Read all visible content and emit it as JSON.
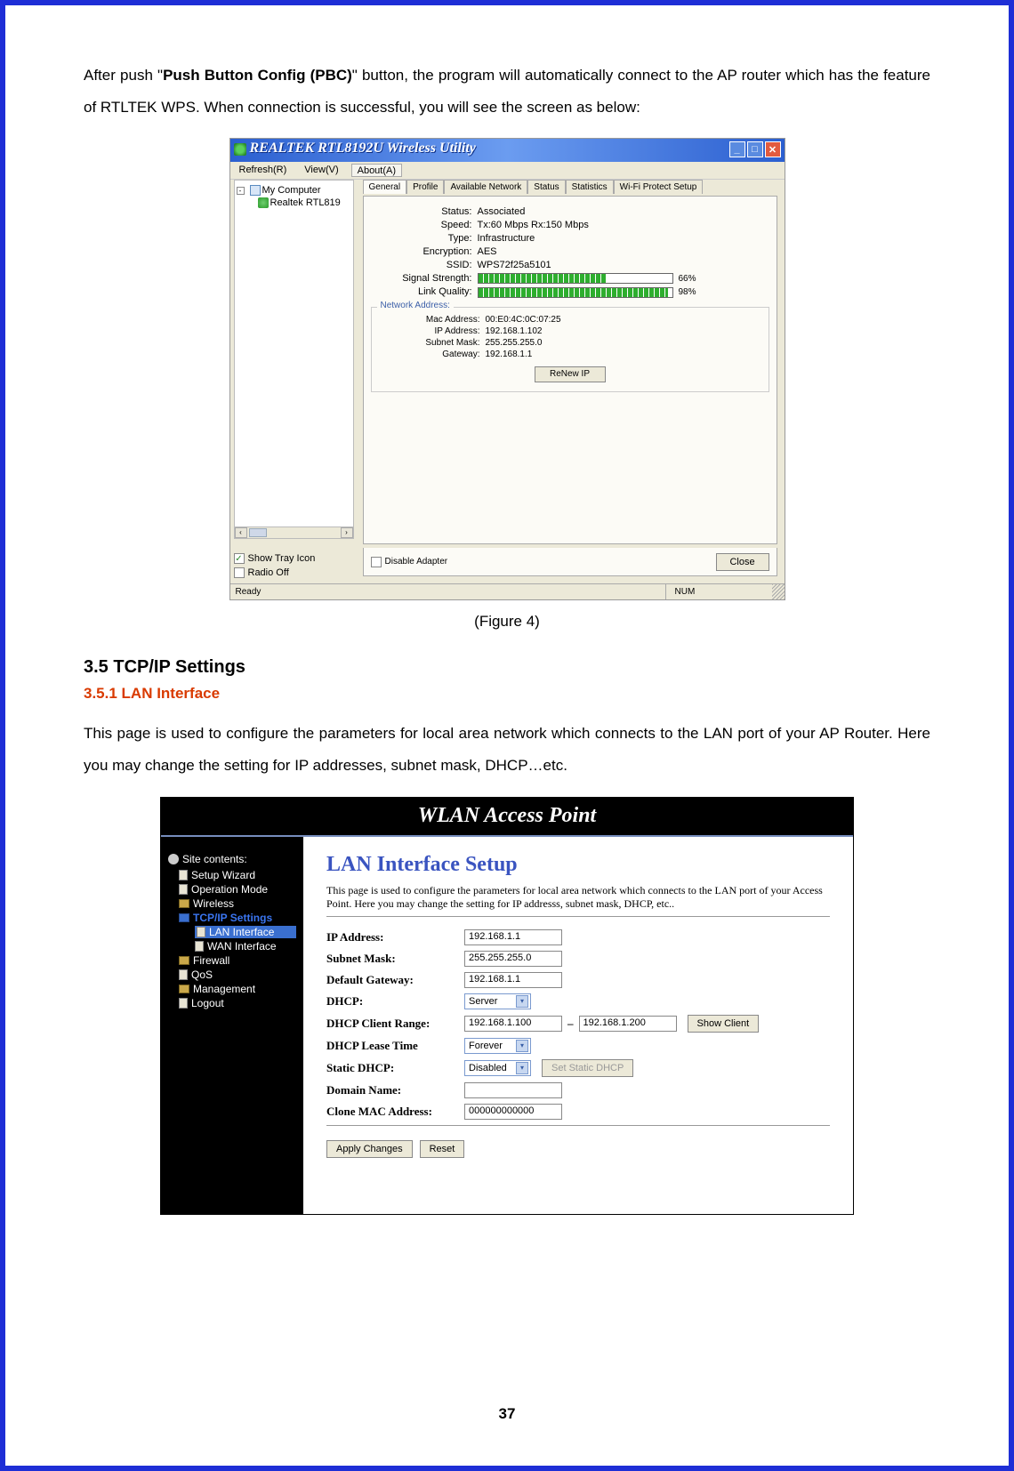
{
  "intro_p1_prefix": "After push \"",
  "intro_p1_bold": "Push Button Config (PBC)",
  "intro_p1_suffix": "\" button, the program will automatically connect to the AP router which has the feature of RTLTEK WPS. When connection is successful, you will see the screen as below:",
  "fig4": {
    "title": "REALTEK RTL8192U Wireless Utility",
    "menu": {
      "refresh": "Refresh(R)",
      "view": "View(V)",
      "about": "About(A)"
    },
    "tree": {
      "root": "My Computer",
      "child": "Realtek RTL819"
    },
    "tabs": {
      "general": "General",
      "profile": "Profile",
      "avail": "Available Network",
      "status": "Status",
      "stats": "Statistics",
      "wps": "Wi-Fi Protect Setup"
    },
    "rows": {
      "status_l": "Status:",
      "status_v": "Associated",
      "speed_l": "Speed:",
      "speed_v": "Tx:60 Mbps Rx:150 Mbps",
      "type_l": "Type:",
      "type_v": "Infrastructure",
      "enc_l": "Encryption:",
      "enc_v": "AES",
      "ssid_l": "SSID:",
      "ssid_v": "WPS72f25a5101",
      "sig_l": "Signal Strength:",
      "sig_pct": "66%",
      "lq_l": "Link Quality:",
      "lq_pct": "98%"
    },
    "network_addr": {
      "title": "Network Address:",
      "mac_l": "Mac Address:",
      "mac_v": "00:E0:4C:0C:07:25",
      "ip_l": "IP Address:",
      "ip_v": "192.168.1.102",
      "mask_l": "Subnet Mask:",
      "mask_v": "255.255.255.0",
      "gw_l": "Gateway:",
      "gw_v": "192.168.1.1",
      "renew": "ReNew IP"
    },
    "checks": {
      "tray": "Show Tray Icon",
      "radio": "Radio Off",
      "disable": "Disable Adapter"
    },
    "close_btn": "Close",
    "status_left": "Ready",
    "status_right": "NUM"
  },
  "caption_fig4": "(Figure 4)",
  "sec35": "3.5    TCP/IP Settings",
  "sec351": "3.5.1    LAN Interface",
  "p_lan": "This page is used to configure the parameters for local area network which connects to the LAN port of your AP Router. Here you may change the setting for IP addresses, subnet mask, DHCP…etc.",
  "fig5": {
    "banner": "WLAN Access Point",
    "nav": {
      "title": "Site contents:",
      "items": {
        "wiz": "Setup Wizard",
        "op": "Operation Mode",
        "wl": "Wireless",
        "tcp": "TCP/IP Settings",
        "lan": "LAN Interface",
        "wan": "WAN Interface",
        "fw": "Firewall",
        "qos": "QoS",
        "mgmt": "Management",
        "logout": "Logout"
      }
    },
    "heading": "LAN Interface Setup",
    "desc": "This page is used to configure the parameters for local area network which connects to the LAN port of your Access Point. Here you may change the setting for IP addresss, subnet mask, DHCP, etc..",
    "form": {
      "ip_l": "IP Address:",
      "ip_v": "192.168.1.1",
      "mask_l": "Subnet Mask:",
      "mask_v": "255.255.255.0",
      "gw_l": "Default Gateway:",
      "gw_v": "192.168.1.1",
      "dhcp_l": "DHCP:",
      "dhcp_v": "Server",
      "range_l": "DHCP Client Range:",
      "range_a": "192.168.1.100",
      "range_dash": "–",
      "range_b": "192.168.1.200",
      "show_client": "Show Client",
      "lease_l": "DHCP Lease Time",
      "lease_v": "Forever",
      "static_l": "Static DHCP:",
      "static_v": "Disabled",
      "static_btn": "Set Static DHCP",
      "domain_l": "Domain Name:",
      "clone_l": "Clone MAC Address:",
      "clone_v": "000000000000"
    },
    "buttons": {
      "apply": "Apply Changes",
      "reset": "Reset"
    }
  },
  "page_number": "37"
}
